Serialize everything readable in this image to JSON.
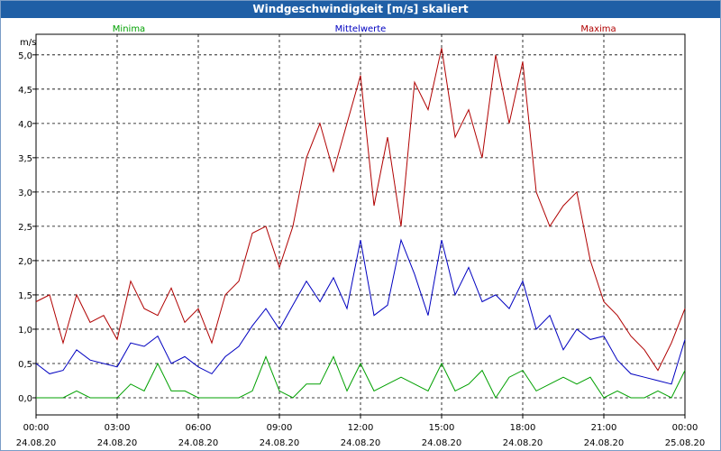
{
  "title": "Windgeschwindigkeit [m/s] skaliert",
  "chart_data": {
    "type": "line",
    "title": "Windgeschwindigkeit [m/s] skaliert",
    "ylabel": "m/s",
    "xlabel": "",
    "ylim": [
      -0.25,
      5.3
    ],
    "xlim": [
      0,
      24
    ],
    "grid": true,
    "legend_placement": "top",
    "y_ticks": [
      "0,0",
      "0,5",
      "1,0",
      "1,5",
      "2,0",
      "2,5",
      "3,0",
      "3,5",
      "4,0",
      "4,5",
      "5,0"
    ],
    "x_ticks": [
      {
        "time": "00:00",
        "date": "24.08.20"
      },
      {
        "time": "03:00",
        "date": "24.08.20"
      },
      {
        "time": "06:00",
        "date": "24.08.20"
      },
      {
        "time": "09:00",
        "date": "24.08.20"
      },
      {
        "time": "12:00",
        "date": "24.08.20"
      },
      {
        "time": "15:00",
        "date": "24.08.20"
      },
      {
        "time": "18:00",
        "date": "24.08.20"
      },
      {
        "time": "21:00",
        "date": "24.08.20"
      },
      {
        "time": "00:00",
        "date": "25.08.20"
      }
    ],
    "series": [
      {
        "name": "Minima",
        "color": "#00a000",
        "x": [
          0,
          0.5,
          1,
          1.5,
          2,
          2.5,
          3,
          3.5,
          4,
          4.5,
          5,
          5.5,
          6,
          6.5,
          7,
          7.5,
          8,
          8.5,
          9,
          9.5,
          10,
          10.5,
          11,
          11.5,
          12,
          12.5,
          13,
          13.5,
          14,
          14.5,
          15,
          15.5,
          16,
          16.5,
          17,
          17.5,
          18,
          18.5,
          19,
          19.5,
          20,
          20.5,
          21,
          21.5,
          22,
          22.5,
          23,
          23.5,
          24
        ],
        "values": [
          0.0,
          0.0,
          0.0,
          0.1,
          0.0,
          0.0,
          0.0,
          0.2,
          0.1,
          0.5,
          0.1,
          0.1,
          0.0,
          0.0,
          0.0,
          0.0,
          0.1,
          0.6,
          0.1,
          0.0,
          0.2,
          0.2,
          0.6,
          0.1,
          0.5,
          0.1,
          0.2,
          0.3,
          0.2,
          0.1,
          0.5,
          0.1,
          0.2,
          0.4,
          0.0,
          0.3,
          0.4,
          0.1,
          0.2,
          0.3,
          0.2,
          0.3,
          0.0,
          0.1,
          0.0,
          0.0,
          0.1,
          0.0,
          0.4
        ]
      },
      {
        "name": "Mittelwerte",
        "color": "#0000c0",
        "x": [
          0,
          0.5,
          1,
          1.5,
          2,
          2.5,
          3,
          3.5,
          4,
          4.5,
          5,
          5.5,
          6,
          6.5,
          7,
          7.5,
          8,
          8.5,
          9,
          9.5,
          10,
          10.5,
          11,
          11.5,
          12,
          12.5,
          13,
          13.5,
          14,
          14.5,
          15,
          15.5,
          16,
          16.5,
          17,
          17.5,
          18,
          18.5,
          19,
          19.5,
          20,
          20.5,
          21,
          21.5,
          22,
          22.5,
          23,
          23.5,
          24
        ],
        "values": [
          0.5,
          0.35,
          0.4,
          0.7,
          0.55,
          0.5,
          0.45,
          0.8,
          0.75,
          0.9,
          0.5,
          0.6,
          0.45,
          0.35,
          0.6,
          0.75,
          1.05,
          1.3,
          1.0,
          1.35,
          1.7,
          1.4,
          1.75,
          1.3,
          2.3,
          1.2,
          1.35,
          2.3,
          1.8,
          1.2,
          2.3,
          1.5,
          1.9,
          1.4,
          1.5,
          1.3,
          1.7,
          1.0,
          1.2,
          0.7,
          1.0,
          0.85,
          0.9,
          0.55,
          0.35,
          0.3,
          0.25,
          0.2,
          0.85
        ]
      },
      {
        "name": "Maxima",
        "color": "#b00000",
        "x": [
          0,
          0.5,
          1,
          1.5,
          2,
          2.5,
          3,
          3.5,
          4,
          4.5,
          5,
          5.5,
          6,
          6.5,
          7,
          7.5,
          8,
          8.5,
          9,
          9.5,
          10,
          10.5,
          11,
          11.5,
          12,
          12.5,
          13,
          13.5,
          14,
          14.5,
          15,
          15.5,
          16,
          16.5,
          17,
          17.5,
          18,
          18.5,
          19,
          19.5,
          20,
          20.5,
          21,
          21.5,
          22,
          22.5,
          23,
          23.5,
          24
        ],
        "values": [
          1.4,
          1.5,
          0.8,
          1.5,
          1.1,
          1.2,
          0.85,
          1.7,
          1.3,
          1.2,
          1.6,
          1.1,
          1.3,
          0.8,
          1.5,
          1.7,
          2.4,
          2.5,
          1.9,
          2.5,
          3.5,
          4.0,
          3.3,
          4.0,
          4.7,
          2.8,
          3.8,
          2.5,
          4.6,
          4.2,
          5.1,
          3.8,
          4.2,
          3.5,
          5.0,
          4.0,
          4.9,
          3.0,
          2.5,
          2.8,
          3.0,
          2.0,
          1.4,
          1.2,
          0.9,
          0.7,
          0.4,
          0.8,
          1.3
        ]
      }
    ]
  }
}
